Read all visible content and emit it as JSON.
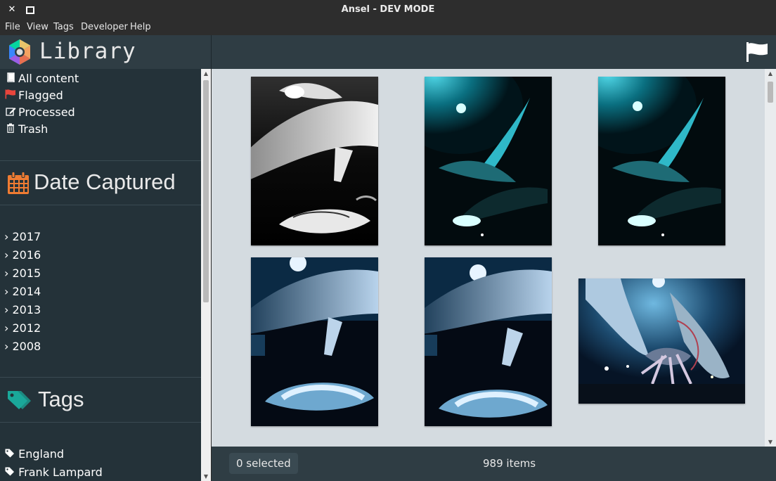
{
  "window": {
    "title": "Ansel - DEV MODE"
  },
  "menu": [
    "File",
    "View",
    "Tags",
    "Developer",
    "Help"
  ],
  "sidebar": {
    "library_title": "Library",
    "nav": [
      {
        "label": "All content",
        "icon": "book-icon"
      },
      {
        "label": "Flagged",
        "icon": "flag-icon"
      },
      {
        "label": "Processed",
        "icon": "edit-icon"
      },
      {
        "label": "Trash",
        "icon": "trash-icon"
      }
    ],
    "date_section": "Date Captured",
    "years": [
      "2017",
      "2016",
      "2015",
      "2014",
      "2013",
      "2012",
      "2008"
    ],
    "tags_section": "Tags",
    "tags": [
      "England",
      "Frank Lampard"
    ]
  },
  "status": {
    "selected": "0 selected",
    "items": "989 items"
  },
  "photos": [
    {
      "name": "photo-bw-whale",
      "style": "bw"
    },
    {
      "name": "photo-teal-orca-1",
      "style": "teal"
    },
    {
      "name": "photo-teal-orca-2",
      "style": "teal"
    },
    {
      "name": "photo-blue-whale-1",
      "style": "blue"
    },
    {
      "name": "photo-blue-whale-2",
      "style": "blue"
    },
    {
      "name": "photo-whale-squid",
      "style": "landscape"
    }
  ],
  "colors": {
    "sidebar_bg": "#243239",
    "header_bg": "#2f3d44",
    "grid_bg": "#d4dbe0",
    "flag_red": "#e8453c",
    "calendar_orange": "#f07c32",
    "tag_teal": "#1aa89a"
  }
}
